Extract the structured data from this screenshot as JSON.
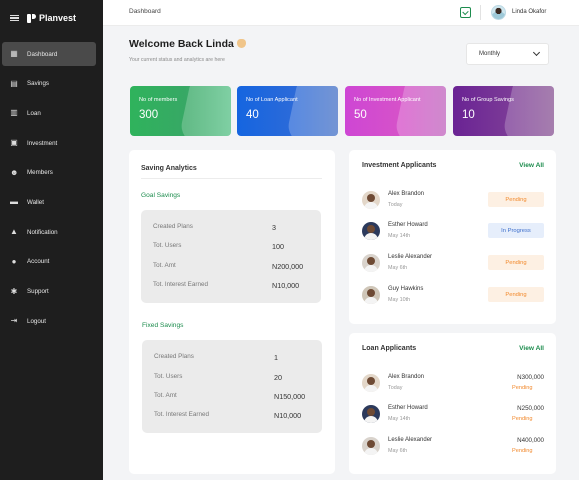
{
  "app": {
    "name": "Planvest"
  },
  "sidebar": {
    "items": [
      {
        "label": "Dashboard",
        "icon": "dashboard-icon",
        "active": true
      },
      {
        "label": "Savings",
        "icon": "savings-icon"
      },
      {
        "label": "Loan",
        "icon": "loan-icon"
      },
      {
        "label": "Investment",
        "icon": "investment-icon"
      },
      {
        "label": "Members",
        "icon": "members-icon"
      },
      {
        "label": "Wallet",
        "icon": "wallet-icon"
      },
      {
        "label": "Notification",
        "icon": "bell-icon"
      },
      {
        "label": "Account",
        "icon": "user-icon"
      },
      {
        "label": "Support",
        "icon": "support-icon"
      },
      {
        "label": "Logout",
        "icon": "logout-icon"
      }
    ]
  },
  "header": {
    "breadcrumb": "Dashboard",
    "user_name": "Linda Okafor"
  },
  "welcome": {
    "title": "Welcome Back Linda",
    "subtitle": "Your current status and analytics are here"
  },
  "period_select": {
    "value": "Monthly"
  },
  "stats": [
    {
      "label": "No of members",
      "value": "300"
    },
    {
      "label": "No of Loan Applicant",
      "value": "40"
    },
    {
      "label": "No of Investment Applicant",
      "value": "50"
    },
    {
      "label": "No of Group Savings",
      "value": "10"
    }
  ],
  "saving_analytics": {
    "title": "Saving Analytics",
    "goal": {
      "title": "Goal Savings",
      "rows": [
        {
          "label": "Created Plans",
          "value": "3"
        },
        {
          "label": "Tot. Users",
          "value": "100"
        },
        {
          "label": "Tot. Amt",
          "value": "N200,000"
        },
        {
          "label": "Tot. Interest Earned",
          "value": "N10,000"
        }
      ]
    },
    "fixed": {
      "title": "Fixed Savings",
      "rows": [
        {
          "label": "Created Plans",
          "value": "1"
        },
        {
          "label": "Tot. Users",
          "value": "20"
        },
        {
          "label": "Tot. Amt",
          "value": "N150,000"
        },
        {
          "label": "Tot. Interest Earned",
          "value": "N10,000"
        }
      ]
    }
  },
  "investment_applicants": {
    "title": "Investment Applicants",
    "view_all": "View All",
    "items": [
      {
        "name": "Alex Brandon",
        "date": "Today",
        "status": "Pending"
      },
      {
        "name": "Esther Howard",
        "date": "May 14th",
        "status": "In Progress"
      },
      {
        "name": "Leslie Alexander",
        "date": "May 6th",
        "status": "Pending"
      },
      {
        "name": "Guy Hawkins",
        "date": "May 10th",
        "status": "Pending"
      }
    ]
  },
  "loan_applicants": {
    "title": "Loan Applicants",
    "view_all": "View All",
    "items": [
      {
        "name": "Alex Brandon",
        "date": "Today",
        "amount": "N300,000",
        "status": "Pending"
      },
      {
        "name": "Esther Howard",
        "date": "May 14th",
        "amount": "N250,000",
        "status": "Pending"
      },
      {
        "name": "Leslie Alexander",
        "date": "May 6th",
        "amount": "N400,000",
        "status": "Pending"
      }
    ]
  },
  "colors": {
    "sidebar_bg": "#1e1e1e",
    "accent_green": "#1c8c4d",
    "pending": "#f28a2e",
    "in_progress": "#3e6fcb",
    "card_members": "#2fb35c",
    "card_loan": "#1565e0",
    "card_investment": "#ce46d4",
    "card_group": "#6a2394"
  }
}
